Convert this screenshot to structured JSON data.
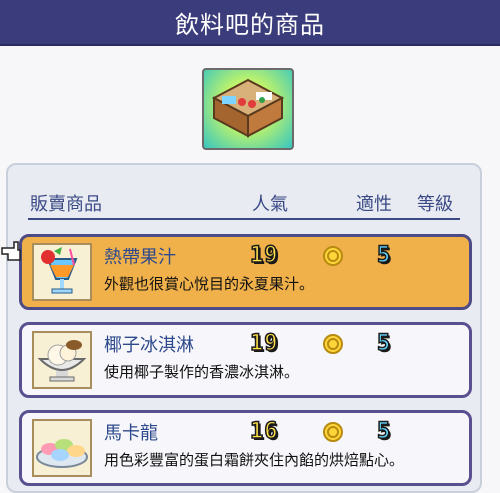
{
  "title": "飲料吧的商品",
  "columns": {
    "product": "販賣商品",
    "popularity": "人氣",
    "affinity": "適性",
    "level": "等級"
  },
  "items": [
    {
      "name": "熱帶果汁",
      "description": "外觀也很賞心悅目的永夏果汁。",
      "popularity": "19",
      "level": "5",
      "selected": true,
      "icon": "tropical-juice-icon"
    },
    {
      "name": "椰子冰淇淋",
      "description": "使用椰子製作的香濃冰淇淋。",
      "popularity": "19",
      "level": "5",
      "selected": false,
      "icon": "coconut-ice-cream-icon"
    },
    {
      "name": "馬卡龍",
      "description": "用色彩豐富的蛋白霜餅夾住內餡的烘焙點心。",
      "popularity": "16",
      "level": "5",
      "selected": false,
      "icon": "macaron-icon"
    }
  ],
  "colors": {
    "title_bar": "#3b3c7c",
    "selected_row": "#f1b14a",
    "header_text": "#3b4a86"
  }
}
